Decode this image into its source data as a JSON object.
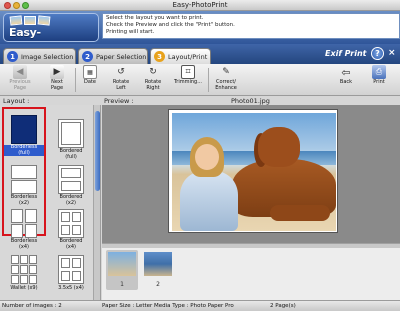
{
  "window": {
    "title": "Easy-PhotoPrint"
  },
  "header": {
    "logo_text": "Easy-PhotoPrint",
    "instructions": "Select the layout you want to print.\nCheck the Preview and click the \"Print\" button.\nPrinting will start."
  },
  "tabs": [
    {
      "num": "1",
      "label": "Image Selection",
      "color": "#2f5ccc"
    },
    {
      "num": "2",
      "label": "Paper Selection",
      "color": "#2f5ccc"
    },
    {
      "num": "3",
      "label": "Layout/Print",
      "color": "#e8a21c"
    }
  ],
  "brand": {
    "exif": "Exif Print",
    "help": "?"
  },
  "toolbar": {
    "previous_page": "Previous\nPage",
    "next_page": "Next\nPage",
    "date": "Date",
    "rotate_left": "Rotate\nLeft",
    "rotate_right": "Rotate\nRight",
    "trimming": "Trimming...",
    "correct_enhance": "Correct/\nEnhance",
    "back": "Back",
    "print": "Print"
  },
  "layout_panel": {
    "title": "Layout :",
    "items": [
      {
        "label": "Borderless\n(full)"
      },
      {
        "label": "Bordered\n(full)"
      },
      {
        "label": "Borderless\n(x2)"
      },
      {
        "label": "Bordered\n(x2)"
      },
      {
        "label": "Borderless\n(x4)"
      },
      {
        "label": "Bordered\n(x4)"
      },
      {
        "label": "Wallet (x9)"
      },
      {
        "label": "3.5x5 (x4)"
      }
    ]
  },
  "preview": {
    "title": "Preview :",
    "filename": "Photo01.jpg"
  },
  "strip": {
    "items": [
      {
        "num": "1"
      },
      {
        "num": "2"
      }
    ]
  },
  "status": {
    "num_images": "Number of images : 2",
    "paper_info": "Paper Size : Letter Media Type : Photo Paper Pro",
    "pages": "2 Page(s)"
  }
}
